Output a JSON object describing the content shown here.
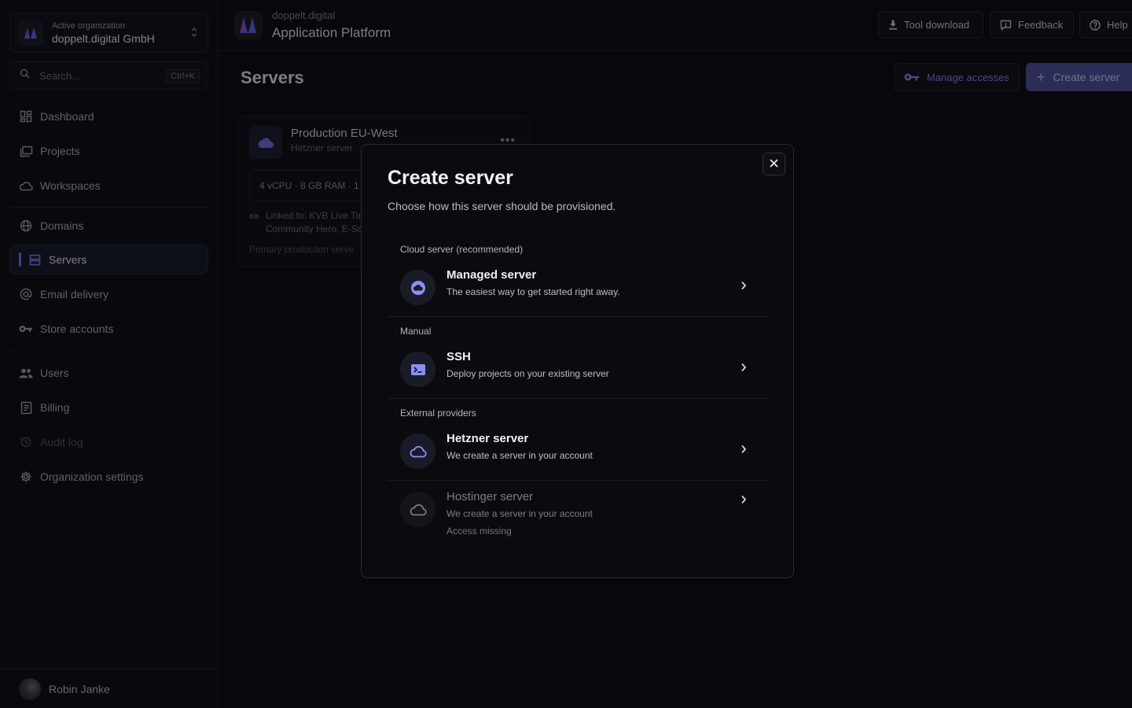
{
  "sidebar": {
    "org": {
      "caption": "Active organization",
      "name": "doppelt.digital GmbH"
    },
    "search": {
      "placeholder": "Search...",
      "shortcut": "Ctrl+K"
    },
    "items": [
      {
        "label": "Dashboard",
        "icon": "dashboard-icon"
      },
      {
        "label": "Projects",
        "icon": "projects-icon"
      },
      {
        "label": "Workspaces",
        "icon": "cloud-icon"
      },
      {
        "label": "Domains",
        "icon": "globe-icon"
      },
      {
        "label": "Servers",
        "icon": "servers-icon",
        "active": true
      },
      {
        "label": "Email delivery",
        "icon": "at-icon"
      },
      {
        "label": "Store accounts",
        "icon": "key-icon"
      },
      {
        "label": "Users",
        "icon": "users-icon"
      },
      {
        "label": "Billing",
        "icon": "billing-icon"
      },
      {
        "label": "Audit log",
        "icon": "history-icon",
        "disabled": true
      },
      {
        "label": "Organization settings",
        "icon": "gear-icon"
      }
    ],
    "user": {
      "name": "Robin Janke"
    }
  },
  "topbar": {
    "subtitle": "doppelt.digital",
    "title": "Application Platform",
    "buttons": {
      "tool_download": "Tool download",
      "feedback": "Feedback",
      "help": "Help"
    }
  },
  "main": {
    "title": "Servers",
    "manage_accesses": "Manage accesses",
    "create_server": "Create server",
    "server_card": {
      "title": "Production EU-West",
      "subtitle": "Hetzner server",
      "specs": "4 vCPU · 8 GB RAM · 1",
      "linked_line1": "Linked to: KVB Live Tir",
      "linked_line2": "Community Hero, E-Sc",
      "description": "Primary production serve"
    }
  },
  "modal": {
    "title": "Create server",
    "description": "Choose how this server should be provisioned.",
    "sections": {
      "cloud": "Cloud server (recommended)",
      "manual": "Manual",
      "external": "External providers"
    },
    "options": {
      "managed": {
        "title": "Managed server",
        "subtitle": "The easiest way to get started right away."
      },
      "ssh": {
        "title": "SSH",
        "subtitle": "Deploy projects on your existing server"
      },
      "hetzner": {
        "title": "Hetzner server",
        "subtitle": "We create a server in your account"
      },
      "hostinger": {
        "title": "Hostinger server",
        "subtitle": "We create a server in your account",
        "note": "Access missing"
      }
    }
  },
  "colors": {
    "accent": "#6b6ff0",
    "primary_button": "#4b4f96",
    "background": "#0b0b10"
  }
}
